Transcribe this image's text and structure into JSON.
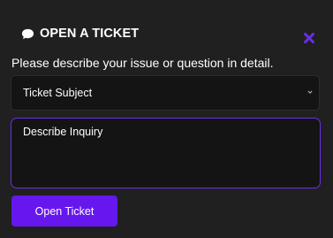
{
  "header": {
    "title": "OPEN A TICKET",
    "title_icon": "chat-bubble-icon",
    "close_icon": "close-x-icon"
  },
  "form": {
    "description": "Please describe your issue or question in detail.",
    "subject_select": {
      "selected": "Ticket Subject"
    },
    "inquiry_field": {
      "placeholder": "Describe Inquiry"
    },
    "submit_label": "Open Ticket"
  },
  "colors": {
    "accent": "#6617ee",
    "panel_bg": "#202020",
    "field_bg": "#141414",
    "focus_border": "#6a2ee8",
    "close_icon": "#6a2ee8",
    "text": "#ffffff"
  }
}
